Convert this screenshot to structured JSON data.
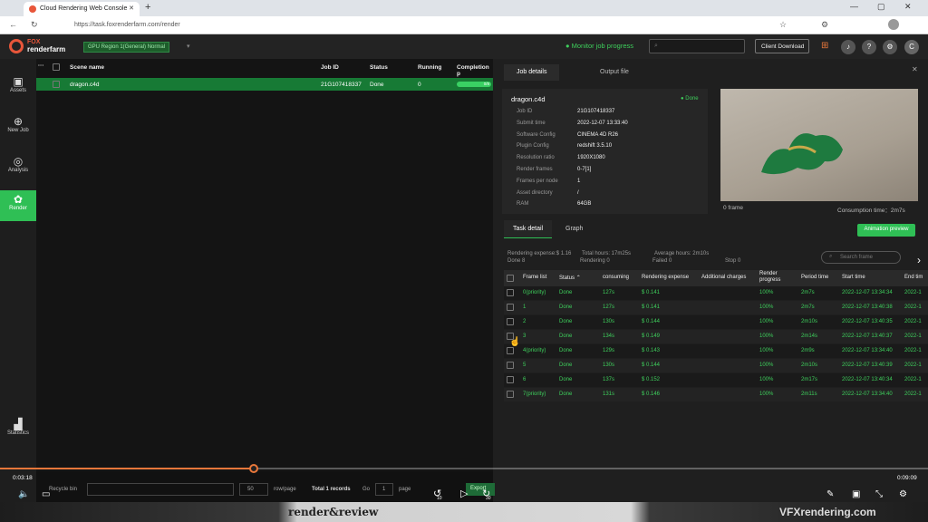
{
  "browser": {
    "tab_title": "Cloud Rendering Web Console",
    "url": "https://task.foxrenderfarm.com/render"
  },
  "header": {
    "logo_top": "FOX",
    "logo_bottom": "renderfarm",
    "region": "GPU Region 1(General)   Normal",
    "monitor": "Monitor job progress",
    "client_download": "Client Download",
    "avatar_letter": "C"
  },
  "sidebar": {
    "items": [
      {
        "label": "Assets",
        "icon": "folder-icon"
      },
      {
        "label": "New Job",
        "icon": "plus-icon"
      },
      {
        "label": "Analysis",
        "icon": "analysis-icon"
      },
      {
        "label": "Render",
        "icon": "render-icon"
      },
      {
        "label": "Statistics",
        "icon": "chart-icon"
      }
    ]
  },
  "jobs": {
    "columns": [
      "Scene name",
      "Job ID",
      "Status",
      "Running",
      "Completion p"
    ],
    "row": {
      "scene": "dragon.c4d",
      "job_id": "21G107418337",
      "status": "Done",
      "running": "0",
      "progress": "0/8"
    }
  },
  "panel": {
    "tabs": [
      "Job details",
      "Output file"
    ],
    "scene": "dragon.c4d",
    "status": "Done",
    "details": [
      [
        "Job ID",
        "21G107418337"
      ],
      [
        "Submit time",
        "2022-12-07 13:33:40"
      ],
      [
        "Software Config",
        "CINEMA 4D R26"
      ],
      [
        "Plugin Config",
        "redshift 3.5.10"
      ],
      [
        "Resolution ratio",
        "1920X1080"
      ],
      [
        "Render frames",
        "0-7[1]"
      ],
      [
        "Frames per node",
        "1"
      ],
      [
        "Asset directory",
        "/"
      ],
      [
        "RAM",
        "64GB"
      ]
    ],
    "preview_frame": "0 frame",
    "consumption": "Consumption time：2m7s",
    "subtabs": [
      "Task detail",
      "Graph"
    ],
    "anim_preview": "Animation preview",
    "summary": {
      "expense": "Rendering expense:$ 1.16",
      "total": "Total hours: 17m25s",
      "avg": "Average hours: 2m10s",
      "done": "Done 8",
      "rendering": "Rendering 0",
      "failed": "Failed 0",
      "stop": "Stop 0"
    },
    "search_placeholder": "Search frame",
    "table_headers": [
      "Frame list",
      "Status",
      "consuming",
      "Rendering expense",
      "Additional charges",
      "Render progress",
      "Period time",
      "Start time",
      "End tim"
    ],
    "rows": [
      [
        "0(priority)",
        "Done",
        "127s",
        "$ 0.141",
        "",
        "100%",
        "2m7s",
        "2022-12-07 13:34:34",
        "2022-1"
      ],
      [
        "1",
        "Done",
        "127s",
        "$ 0.141",
        "",
        "100%",
        "2m7s",
        "2022-12-07 13:40:38",
        "2022-1"
      ],
      [
        "2",
        "Done",
        "130s",
        "$ 0.144",
        "",
        "100%",
        "2m10s",
        "2022-12-07 13:40:35",
        "2022-1"
      ],
      [
        "3",
        "Done",
        "134s",
        "$ 0.149",
        "",
        "100%",
        "2m14s",
        "2022-12-07 13:40:37",
        "2022-1"
      ],
      [
        "4(priority)",
        "Done",
        "129s",
        "$ 0.143",
        "",
        "100%",
        "2m9s",
        "2022-12-07 13:34:40",
        "2022-1"
      ],
      [
        "5",
        "Done",
        "130s",
        "$ 0.144",
        "",
        "100%",
        "2m10s",
        "2022-12-07 13:40:39",
        "2022-1"
      ],
      [
        "6",
        "Done",
        "137s",
        "$ 0.152",
        "",
        "100%",
        "2m17s",
        "2022-12-07 13:40:34",
        "2022-1"
      ],
      [
        "7(priority)",
        "Done",
        "131s",
        "$ 0.146",
        "",
        "100%",
        "2m11s",
        "2022-12-07 13:34:40",
        "2022-1"
      ]
    ]
  },
  "pager": {
    "recycle": "Recycle bin",
    "per_page": "50",
    "row_page": "row/page",
    "total": "Total 1 records",
    "go": "Go",
    "page_num": "1",
    "page": "page",
    "export": "Export"
  },
  "video": {
    "current": "00:18",
    "duration": "0:09:09",
    "current_label": "0:03:18",
    "progress": 0.27,
    "skip_back": "10",
    "skip_fwd": "30"
  },
  "watermark": {
    "left": "render&review",
    "right": "VFXrendering.com"
  }
}
